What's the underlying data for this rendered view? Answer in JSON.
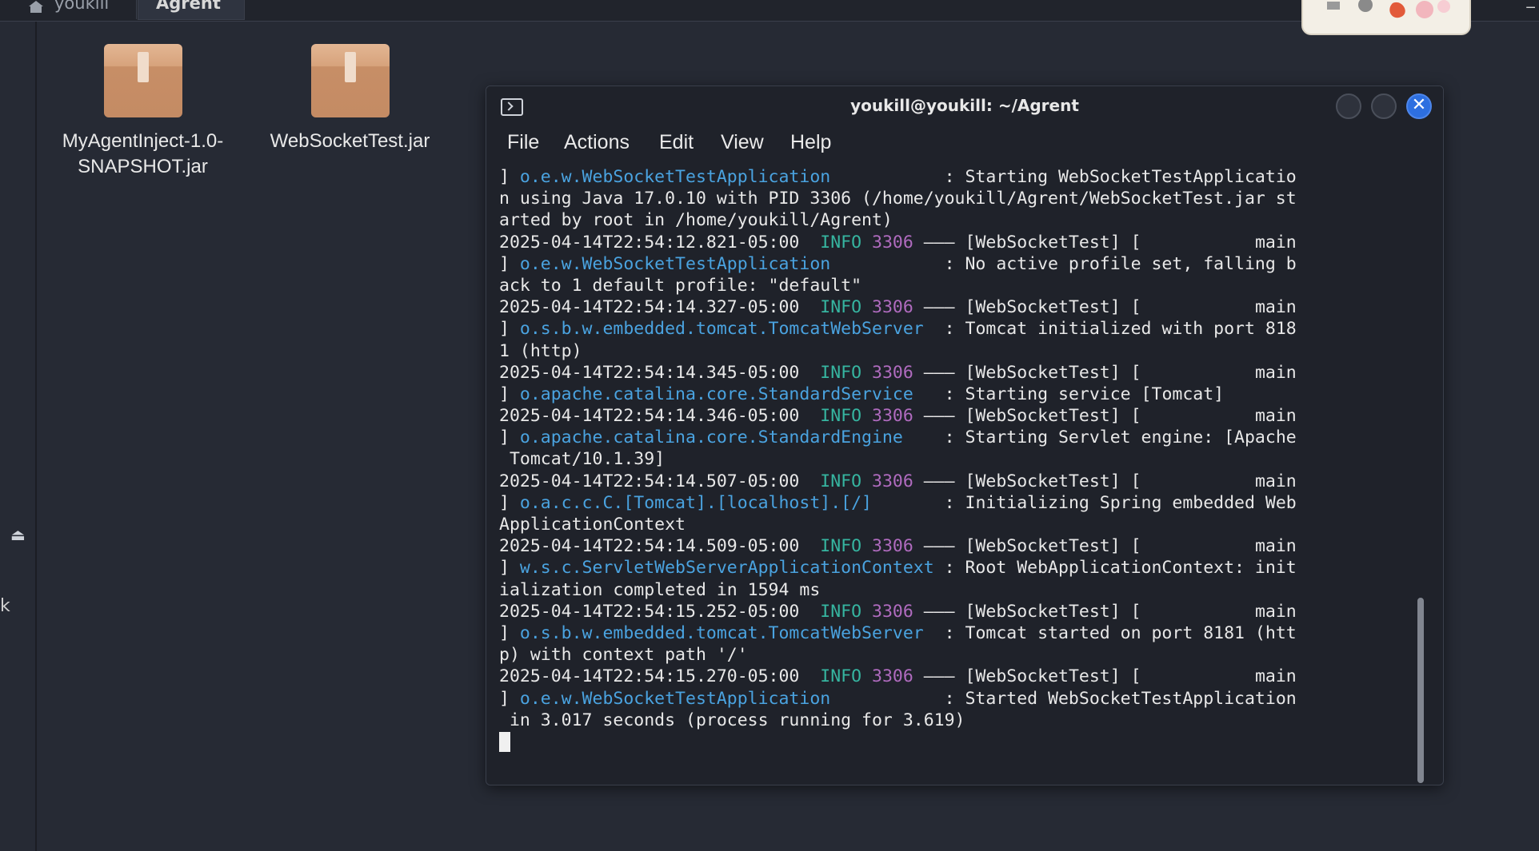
{
  "pathbar": {
    "home_label": "youkill",
    "current_label": "Agrent"
  },
  "desktop": {
    "files": [
      {
        "name_line1": "MyAgentInject-1.0-",
        "name_line2": "SNAPSHOT.jar",
        "icon": "package-icon"
      },
      {
        "name_line1": "WebSocketTest.jar",
        "name_line2": "",
        "icon": "package-icon"
      }
    ]
  },
  "sidepane": {
    "eject_glyph": "⏏",
    "partial_letter": "k"
  },
  "terminal": {
    "title": "youkill@youkill: ~/Agrent",
    "close_glyph": "✕",
    "menu": [
      "File",
      "Actions",
      "Edit",
      "View",
      "Help"
    ],
    "colors": {
      "class": "#4aa3e0",
      "level": "#36b5a0",
      "pid": "#b06bbf"
    },
    "lines": [
      [
        {
          "t": "] "
        },
        {
          "t": "o.e.w.WebSocketTestApplication",
          "c": "cls"
        },
        {
          "t": "           : Starting WebSocketTestApplicatio"
        }
      ],
      [
        {
          "t": "n using Java 17.0.10 with PID 3306 (/home/youkill/Agrent/WebSocketTest.jar st"
        }
      ],
      [
        {
          "t": "arted by root in /home/youkill/Agrent)"
        }
      ],
      [
        {
          "t": "2025-04-14T22:54:12.821-05:00  "
        },
        {
          "t": "INFO",
          "c": "lvl"
        },
        {
          "t": " "
        },
        {
          "t": "3306",
          "c": "pid"
        },
        {
          "t": " ——— [WebSocketTest] [           main"
        }
      ],
      [
        {
          "t": "] "
        },
        {
          "t": "o.e.w.WebSocketTestApplication",
          "c": "cls"
        },
        {
          "t": "           : No active profile set, falling b"
        }
      ],
      [
        {
          "t": "ack to 1 default profile: \"default\""
        }
      ],
      [
        {
          "t": "2025-04-14T22:54:14.327-05:00  "
        },
        {
          "t": "INFO",
          "c": "lvl"
        },
        {
          "t": " "
        },
        {
          "t": "3306",
          "c": "pid"
        },
        {
          "t": " ——— [WebSocketTest] [           main"
        }
      ],
      [
        {
          "t": "] "
        },
        {
          "t": "o.s.b.w.embedded.tomcat.TomcatWebServer",
          "c": "cls"
        },
        {
          "t": "  : Tomcat initialized with port 818"
        }
      ],
      [
        {
          "t": "1 (http)"
        }
      ],
      [
        {
          "t": "2025-04-14T22:54:14.345-05:00  "
        },
        {
          "t": "INFO",
          "c": "lvl"
        },
        {
          "t": " "
        },
        {
          "t": "3306",
          "c": "pid"
        },
        {
          "t": " ——— [WebSocketTest] [           main"
        }
      ],
      [
        {
          "t": "] "
        },
        {
          "t": "o.apache.catalina.core.StandardService",
          "c": "cls"
        },
        {
          "t": "   : Starting service [Tomcat]"
        }
      ],
      [
        {
          "t": "2025-04-14T22:54:14.346-05:00  "
        },
        {
          "t": "INFO",
          "c": "lvl"
        },
        {
          "t": " "
        },
        {
          "t": "3306",
          "c": "pid"
        },
        {
          "t": " ——— [WebSocketTest] [           main"
        }
      ],
      [
        {
          "t": "] "
        },
        {
          "t": "o.apache.catalina.core.StandardEngine",
          "c": "cls"
        },
        {
          "t": "    : Starting Servlet engine: [Apache"
        }
      ],
      [
        {
          "t": " Tomcat/10.1.39]"
        }
      ],
      [
        {
          "t": "2025-04-14T22:54:14.507-05:00  "
        },
        {
          "t": "INFO",
          "c": "lvl"
        },
        {
          "t": " "
        },
        {
          "t": "3306",
          "c": "pid"
        },
        {
          "t": " ——— [WebSocketTest] [           main"
        }
      ],
      [
        {
          "t": "] "
        },
        {
          "t": "o.a.c.c.C.[Tomcat].[localhost].[/]",
          "c": "cls"
        },
        {
          "t": "       : Initializing Spring embedded Web"
        }
      ],
      [
        {
          "t": "ApplicationContext"
        }
      ],
      [
        {
          "t": "2025-04-14T22:54:14.509-05:00  "
        },
        {
          "t": "INFO",
          "c": "lvl"
        },
        {
          "t": " "
        },
        {
          "t": "3306",
          "c": "pid"
        },
        {
          "t": " ——— [WebSocketTest] [           main"
        }
      ],
      [
        {
          "t": "] "
        },
        {
          "t": "w.s.c.ServletWebServerApplicationContext",
          "c": "cls"
        },
        {
          "t": " : Root WebApplicationContext: init"
        }
      ],
      [
        {
          "t": "ialization completed in 1594 ms"
        }
      ],
      [
        {
          "t": "2025-04-14T22:54:15.252-05:00  "
        },
        {
          "t": "INFO",
          "c": "lvl"
        },
        {
          "t": " "
        },
        {
          "t": "3306",
          "c": "pid"
        },
        {
          "t": " ——— [WebSocketTest] [           main"
        }
      ],
      [
        {
          "t": "] "
        },
        {
          "t": "o.s.b.w.embedded.tomcat.TomcatWebServer",
          "c": "cls"
        },
        {
          "t": "  : Tomcat started on port 8181 (htt"
        }
      ],
      [
        {
          "t": "p) with context path '/'"
        }
      ],
      [
        {
          "t": "2025-04-14T22:54:15.270-05:00  "
        },
        {
          "t": "INFO",
          "c": "lvl"
        },
        {
          "t": " "
        },
        {
          "t": "3306",
          "c": "pid"
        },
        {
          "t": " ——— [WebSocketTest] [           main"
        }
      ],
      [
        {
          "t": "] "
        },
        {
          "t": "o.e.w.WebSocketTestApplication",
          "c": "cls"
        },
        {
          "t": "           : Started WebSocketTestApplication"
        }
      ],
      [
        {
          "t": " in 3.017 seconds (process running for 3.619)"
        }
      ]
    ]
  }
}
